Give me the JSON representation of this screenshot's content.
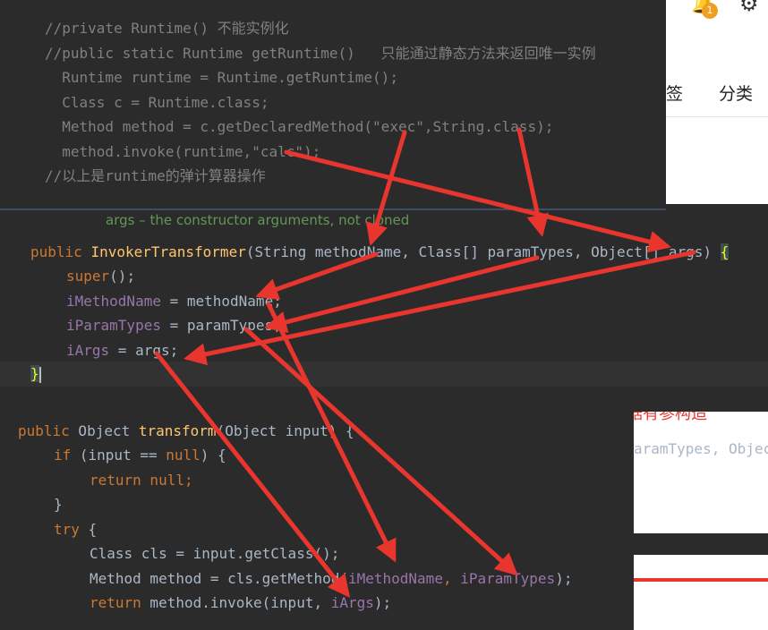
{
  "background_page": {
    "nav_items": [
      "签",
      "分类"
    ],
    "notification_badge": "1",
    "partial_heading": "据有参构造",
    "partial_code": "aramTypes, Objec"
  },
  "top_panel": {
    "lines": [
      "//private Runtime() 不能实例化",
      "//public static Runtime getRuntime()   只能通过静态方法来返回唯一实例",
      "  Runtime runtime = Runtime.getRuntime();",
      "  Class c = Runtime.class;",
      "  Method method = c.getDeclaredMethod(\"exec\",String.class);",
      "  method.invoke(runtime,\"calc\");",
      "//以上是runtime的弹计算器操作"
    ]
  },
  "middle_panel": {
    "doc_line": "args – the constructor arguments, not cloned",
    "constructor": {
      "modifier": "public",
      "name": "InvokerTransformer",
      "params": "(String methodName, Class[] paramTypes, Object[] args) ",
      "open_brace": "{"
    },
    "body": [
      {
        "target": "super",
        "rest": "();"
      },
      {
        "target": "iMethodName",
        "rest": " = methodName;"
      },
      {
        "target": "iParamTypes",
        "rest": " = paramTypes;"
      },
      {
        "target": "iArgs",
        "rest": " = args;"
      }
    ],
    "close_brace": "}"
  },
  "bottom_panel": {
    "signature": {
      "modifier": "public",
      "type": " Object ",
      "name": "transform",
      "params": "(Object input) {"
    },
    "if_line": {
      "kw": "if",
      "open": " (input == ",
      "null": "null",
      "close": ") {"
    },
    "return_null": {
      "kw": "return",
      "value": " null",
      "semi": ";"
    },
    "close1": "}",
    "try_line": {
      "kw": "try",
      "rest": " {"
    },
    "class_line": "Class cls = input.getClass();",
    "method_line": {
      "pre": "Method method = cls.getMethod(",
      "a1": "iMethodName",
      "sep": ", ",
      "a2": "iParamTypes",
      "post": ");"
    },
    "return_line": {
      "kw": "return",
      "pre": " method.invoke(input, ",
      "a1": "iArgs",
      "post": ");"
    }
  },
  "annotation_color": "#e8352e"
}
